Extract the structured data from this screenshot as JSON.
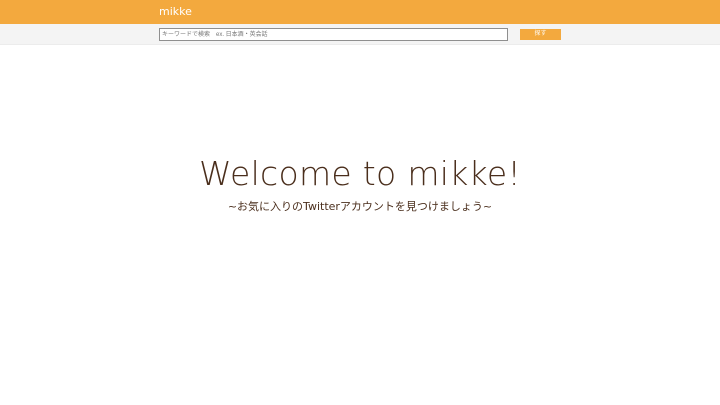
{
  "navbar": {
    "brand": "mikke"
  },
  "search": {
    "placeholder": "キーワードで検索　ex. 日本酒・英会話",
    "value": "",
    "button_label": "探す"
  },
  "hero": {
    "title": "Welcome to mikke!",
    "subtitle": "~お気に入りのTwitterアカウントを見つけましょう~"
  },
  "colors": {
    "accent": "#f3a93e",
    "hero_text": "#4a2e1c",
    "search_bar_bg": "#f4f4f4"
  }
}
